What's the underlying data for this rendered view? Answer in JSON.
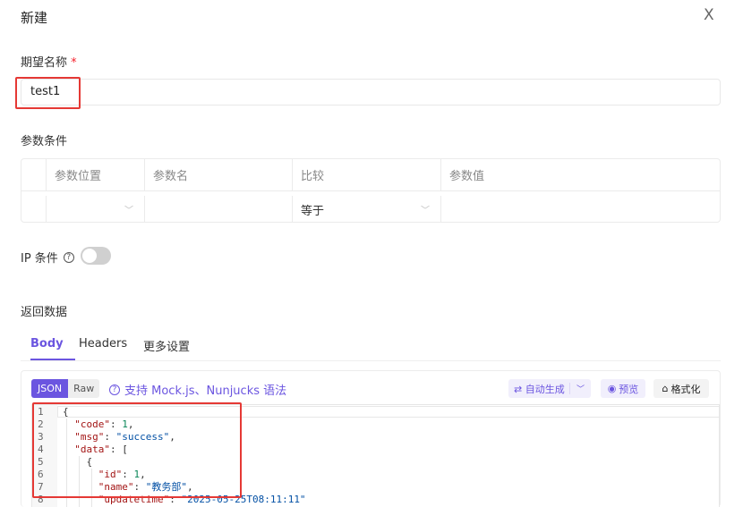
{
  "dialog": {
    "title": "新建",
    "close_glyph": "X"
  },
  "form": {
    "expect_name_label": "期望名称",
    "required_mark": "*",
    "expect_name_value": "test1",
    "param_conditions_label": "参数条件",
    "param_table": {
      "columns": [
        "参数位置",
        "参数名",
        "比较",
        "参数值"
      ],
      "row": {
        "position": "",
        "name": "",
        "compare": "等于",
        "value": ""
      }
    },
    "ip_condition_label": "IP 条件",
    "ip_condition_enabled": false,
    "return_data_label": "返回数据"
  },
  "tabs": [
    {
      "label": "Body",
      "active": true
    },
    {
      "label": "Headers",
      "active": false
    },
    {
      "label": "更多设置",
      "active": false
    }
  ],
  "editor_toolbar": {
    "mode_json": "JSON",
    "mode_raw": "Raw",
    "selected_mode": "JSON",
    "hint_text": "支持 Mock.js、Nunjucks 语法",
    "auto_generate_label": "自动生成",
    "preview_label": "预览",
    "format_label": "格式化"
  },
  "code_lines": [
    {
      "no": "1",
      "text": "{"
    },
    {
      "no": "2",
      "key": "\"code\"",
      "value": "1",
      "suffix": ","
    },
    {
      "no": "3",
      "key": "\"msg\"",
      "value": "\"success\"",
      "suffix": ","
    },
    {
      "no": "4",
      "key": "\"data\"",
      "value": "[",
      "suffix": ""
    },
    {
      "no": "5",
      "text": "{"
    },
    {
      "no": "6",
      "key": "\"id\"",
      "value": "1",
      "suffix": ","
    },
    {
      "no": "7",
      "key": "\"name\"",
      "value": "\"教务部\"",
      "suffix": ","
    },
    {
      "no": "8",
      "key": "\"updatetime\"",
      "value": "\"2025-05-25T08:11:11\"",
      "suffix": ""
    }
  ],
  "colors": {
    "accent": "#6b55e0",
    "highlight_box": "#e53935",
    "required": "#f5222d"
  }
}
